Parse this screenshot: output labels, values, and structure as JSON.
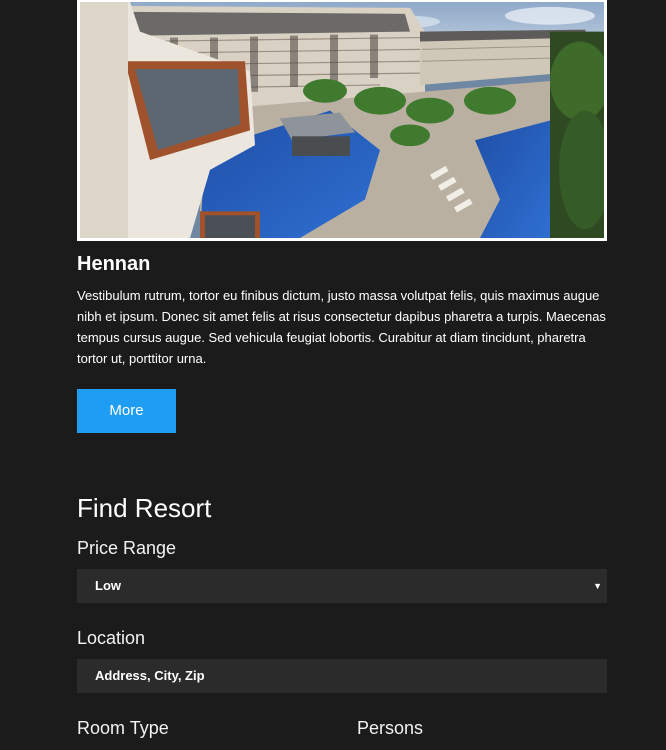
{
  "resort": {
    "name": "Hennan",
    "description": "Vestibulum rutrum, tortor eu finibus dictum, justo massa volutpat felis, quis maximus augue nibh et ipsum. Donec sit amet felis at risus consectetur dapibus pharetra a turpis. Maecenas tempus cursus augue. Sed vehicula feugiat lobortis. Curabitur at diam tincidunt, pharetra tortor ut, porttitor urna.",
    "more_label": "More"
  },
  "find_resort": {
    "title": "Find Resort",
    "price_range": {
      "label": "Price Range",
      "selected": "Low",
      "caret": "▼"
    },
    "location": {
      "label": "Location",
      "placeholder": "Address, City, Zip"
    },
    "room_type": {
      "label": "Room Type"
    },
    "persons": {
      "label": "Persons"
    }
  },
  "colors": {
    "page_background": "#1b1b1b",
    "accent": "#1e9df2",
    "field_background": "#2b2b2b"
  }
}
